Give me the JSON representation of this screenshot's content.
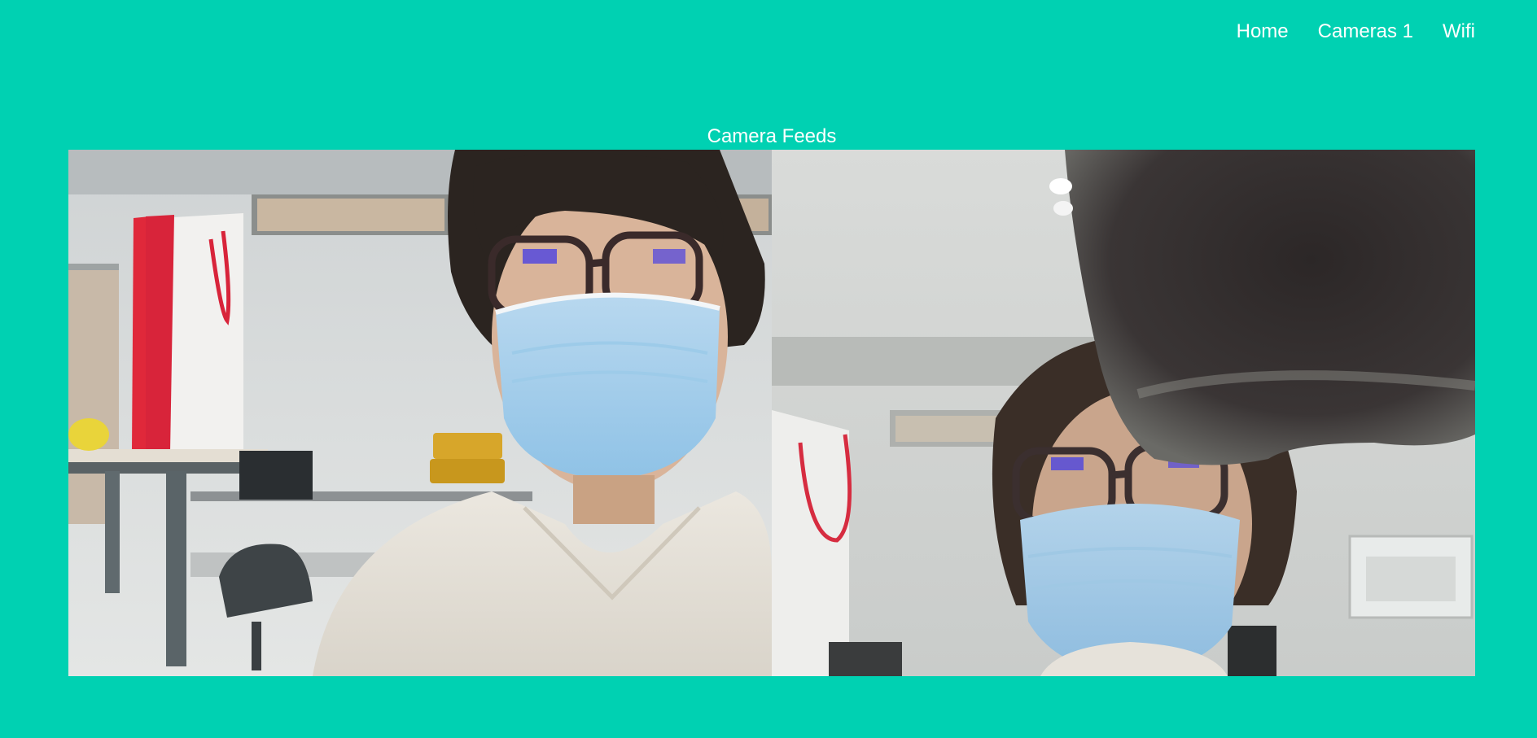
{
  "nav": {
    "home_label": "Home",
    "cameras_label": "Cameras 1",
    "wifi_label": "Wifi"
  },
  "main": {
    "title": "Camera Feeds"
  },
  "feeds": [
    {
      "feed_name": "camera-feed-left"
    },
    {
      "feed_name": "camera-feed-right"
    }
  ],
  "colors": {
    "background": "#00d1b2",
    "text": "#ffffff"
  }
}
